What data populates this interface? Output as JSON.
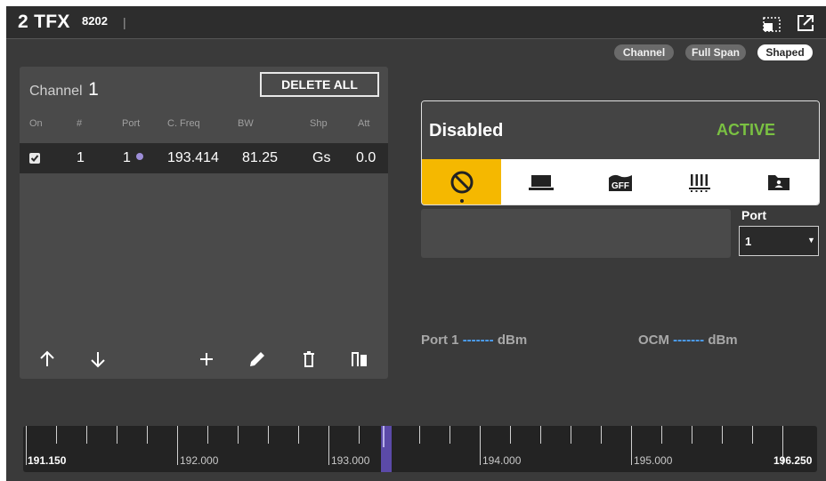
{
  "header": {
    "title": "2 TFX",
    "subtitle": "8202",
    "caret": "|"
  },
  "view_pills": [
    {
      "label": "Channel",
      "selected": false
    },
    {
      "label": "Full Span",
      "selected": false
    },
    {
      "label": "Shaped",
      "selected": true
    }
  ],
  "channel_panel": {
    "title_label": "Channel",
    "title_number": "1",
    "delete_all_label": "DELETE ALL",
    "columns": [
      "On",
      "#",
      "Port",
      "C. Freq",
      "BW",
      "Shp",
      "Att"
    ],
    "rows": [
      {
        "on": true,
        "num": "1",
        "port": "1",
        "cfreq": "193.414",
        "bw": "81.25",
        "shp": "Gs",
        "att": "0.0",
        "port_color": "#9d8ed8"
      }
    ],
    "toolbar_icons": [
      "arrow-up-icon",
      "arrow-down-icon",
      "plus-icon",
      "pencil-icon",
      "trash-icon",
      "columns-icon"
    ]
  },
  "state_card": {
    "status_label": "Disabled",
    "active_label": "ACTIVE",
    "active_color": "#7ac142",
    "selected_color": "#f5b800",
    "modes": [
      "disabled-icon",
      "laptop-icon",
      "gff-icon",
      "grid-icon",
      "folder-icon"
    ],
    "gff_text": "GFF"
  },
  "port_selector": {
    "label": "Port",
    "value": "1"
  },
  "power_readout": {
    "port1_label": "Port 1",
    "port1_value": "-------",
    "port1_unit": "dBm",
    "ocm_label": "OCM",
    "ocm_value": "-------",
    "ocm_unit": "dBm"
  },
  "frequency_ruler": {
    "start": "191.150",
    "end": "196.250",
    "labels": [
      "192.000",
      "193.000",
      "194.000",
      "195.000"
    ]
  }
}
